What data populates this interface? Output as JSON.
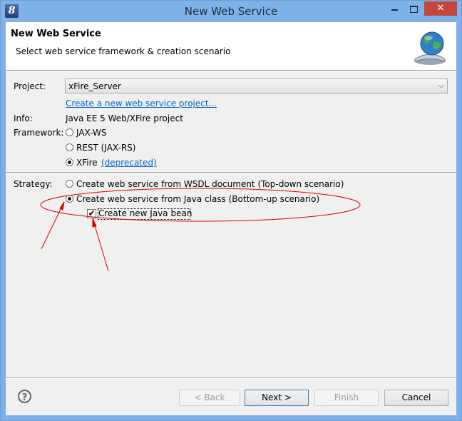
{
  "window": {
    "title": "New Web Service",
    "close_label": "✕"
  },
  "banner": {
    "title": "New Web Service",
    "description": "Select web service framework & creation scenario"
  },
  "form": {
    "project_label": "Project:",
    "project_value": "xFire_Server",
    "create_project_link": "Create a new web service project...",
    "info_label": "Info:",
    "info_value": "Java EE 5 Web/XFire project",
    "framework_label": "Framework:",
    "frameworks": [
      {
        "label": "JAX-WS",
        "selected": false
      },
      {
        "label": "REST (JAX-RS)",
        "selected": false
      },
      {
        "label": "XFire",
        "selected": true
      }
    ],
    "deprecated_link": "(deprecated)",
    "strategy_label": "Strategy:",
    "strategies": [
      {
        "label": "Create web service from WSDL document (Top-down scenario)",
        "selected": false
      },
      {
        "label": "Create web service from Java class (Bottom-up scenario)",
        "selected": true
      }
    ],
    "create_bean_label": "Create new Java bean",
    "create_bean_checked": true,
    "checkmark": "✔"
  },
  "buttons": {
    "back": "< Back",
    "next": "Next >",
    "finish": "Finish",
    "cancel": "Cancel",
    "help": "?"
  },
  "colors": {
    "annotation": "#e00000",
    "link": "#0066cc",
    "close_button": "#c7463c"
  }
}
